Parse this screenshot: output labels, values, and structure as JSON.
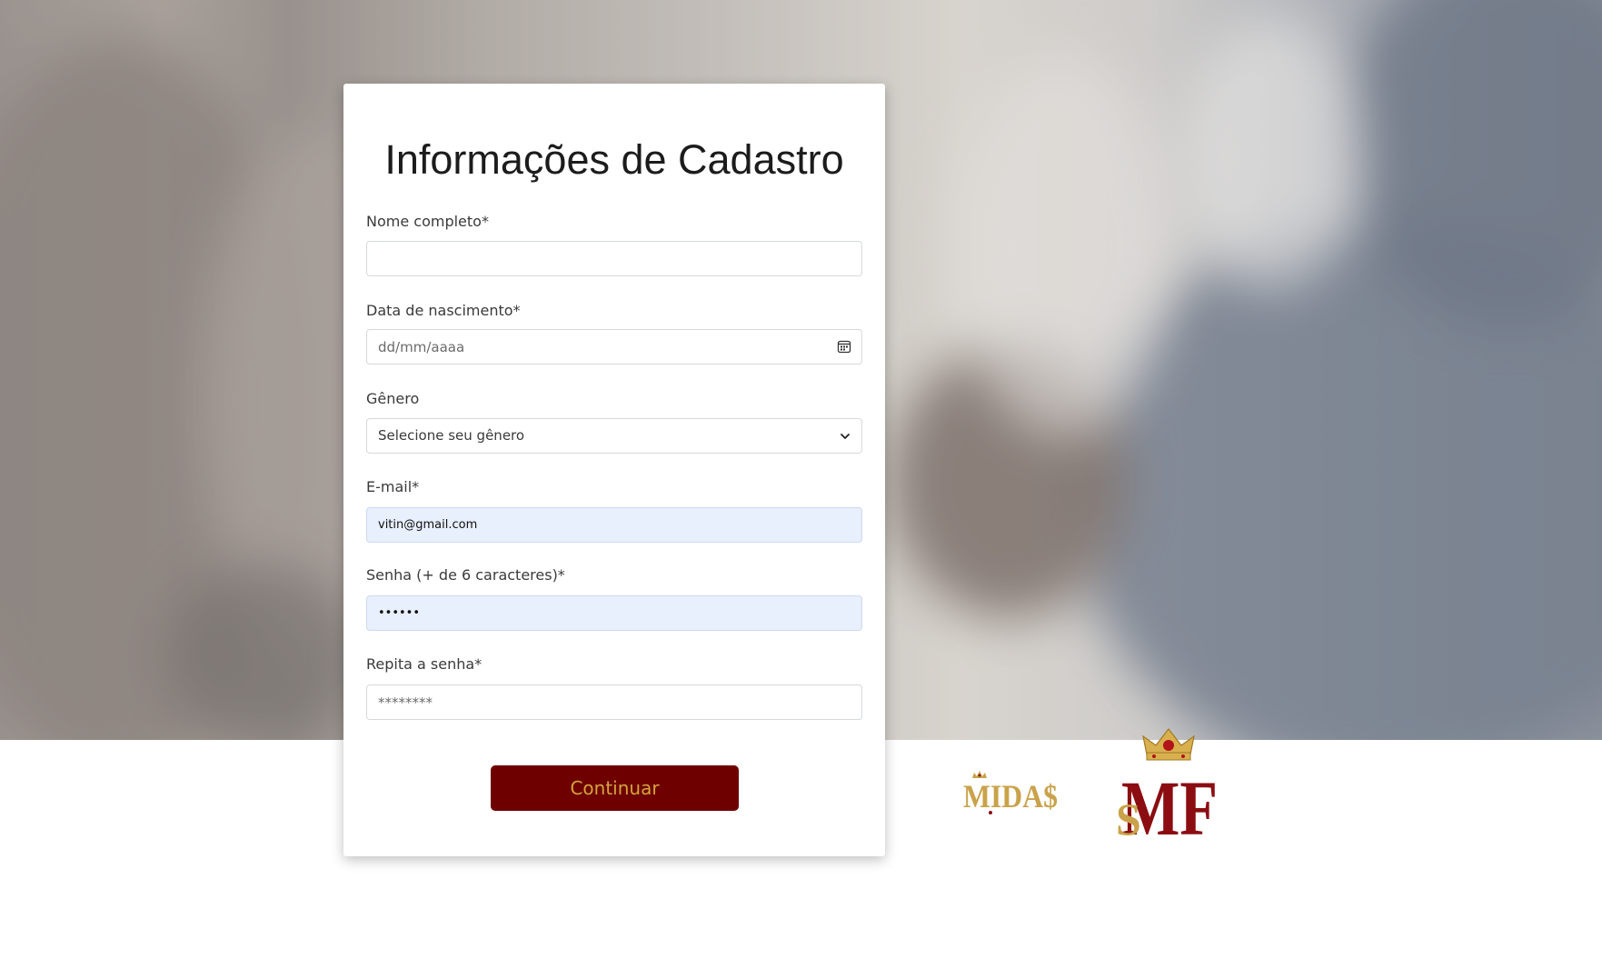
{
  "form": {
    "title": "Informações de Cadastro",
    "fields": {
      "full_name": {
        "label": "Nome completo*",
        "value": "",
        "placeholder": ""
      },
      "birth_date": {
        "label": "Data de nascimento*",
        "placeholder": "dd/mm/aaaa"
      },
      "gender": {
        "label": "Gênero",
        "selected": "Selecione seu gênero"
      },
      "email": {
        "label": "E-mail*",
        "value": "vitin@gmail.com"
      },
      "password": {
        "label": "Senha (+ de 6 caracteres)*",
        "value": "••••••"
      },
      "repeat_password": {
        "label": "Repita a senha*",
        "placeholder": "********"
      }
    },
    "submit_label": "Continuar"
  },
  "logos": {
    "midas": "MIDA$",
    "mf": "MF"
  },
  "colors": {
    "button_bg": "#6e0000",
    "button_text": "#d5a43d",
    "autofill_bg": "#e8effd",
    "brand_gold": "#c9a24a",
    "brand_red": "#8b0d12"
  },
  "icons": {
    "date": "calendar-icon",
    "select": "chevron-down-icon",
    "crown": "crown-icon"
  }
}
